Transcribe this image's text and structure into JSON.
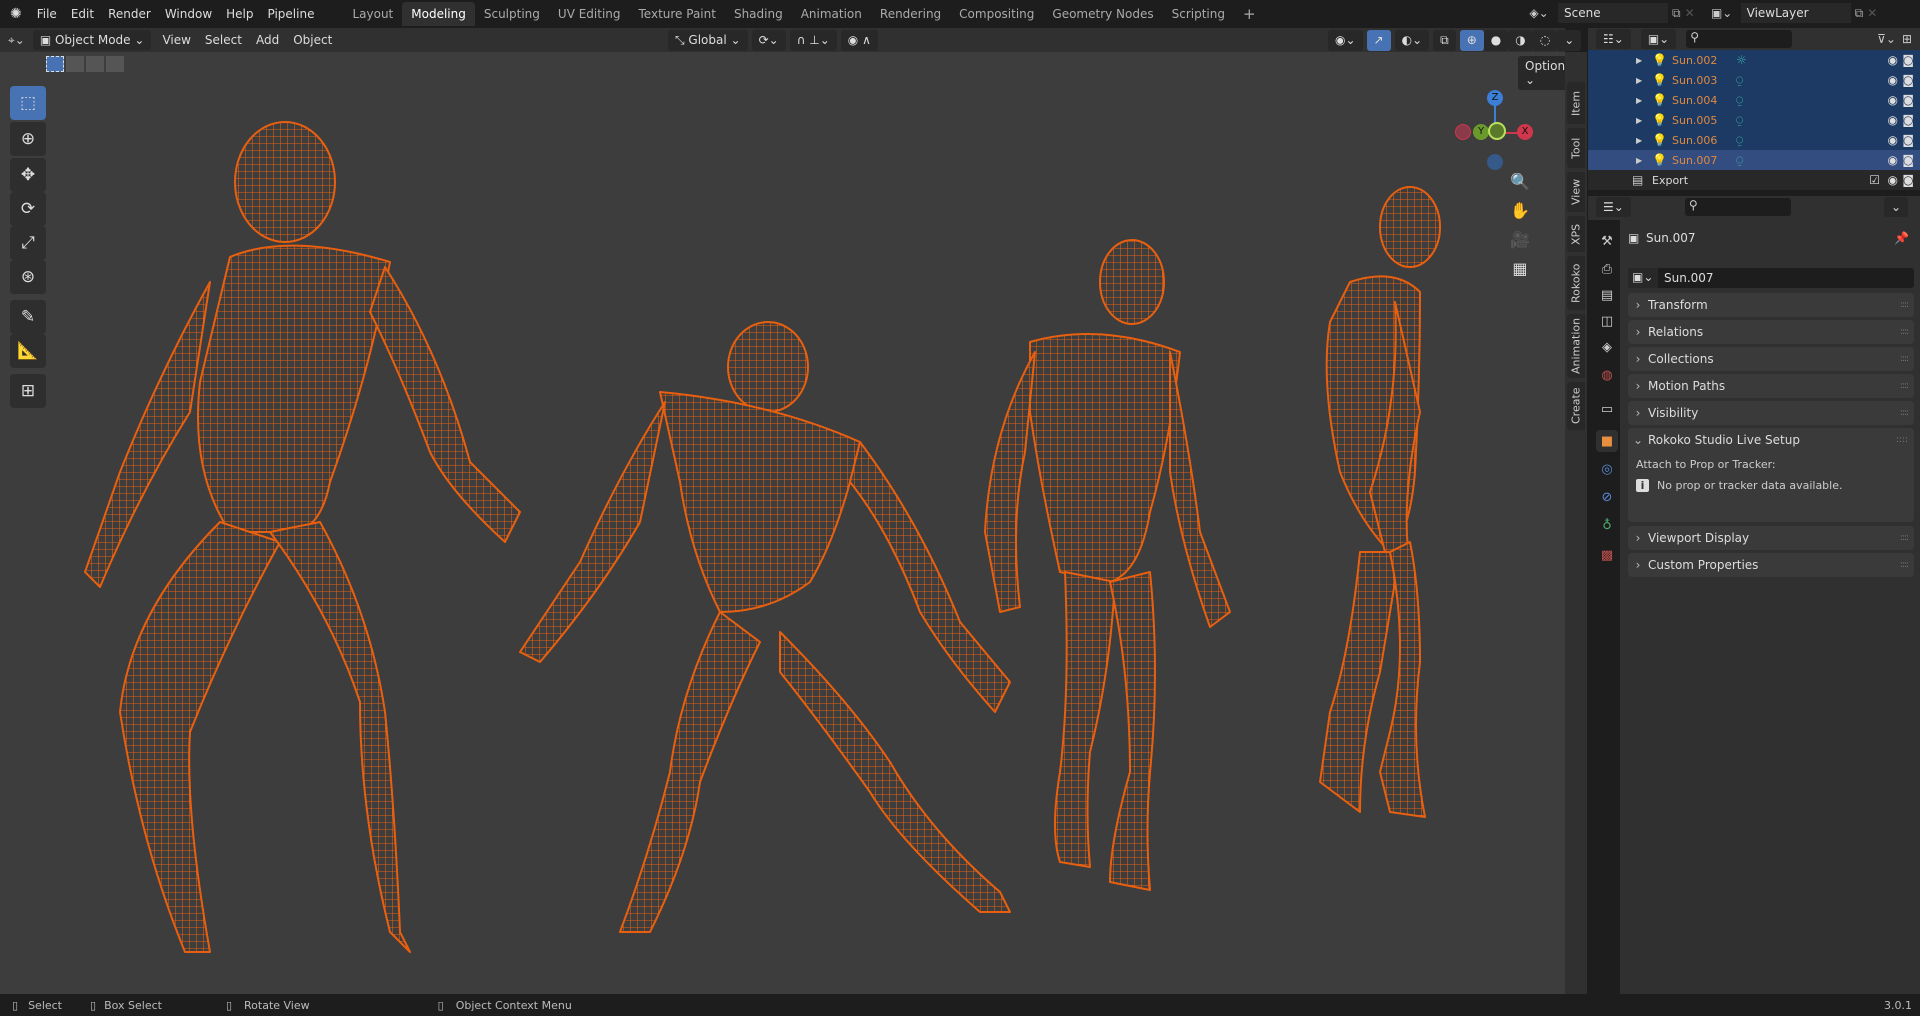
{
  "topbar": {
    "menus": [
      "File",
      "Edit",
      "Render",
      "Window",
      "Help",
      "Pipeline"
    ],
    "workspaces": [
      "Layout",
      "Modeling",
      "Sculpting",
      "UV Editing",
      "Texture Paint",
      "Shading",
      "Animation",
      "Rendering",
      "Compositing",
      "Geometry Nodes",
      "Scripting"
    ],
    "active_workspace": "Modeling",
    "add_tab": "+",
    "scene": "Scene",
    "view_layer": "ViewLayer"
  },
  "viewport_header": {
    "mode": "Object Mode",
    "menus": [
      "View",
      "Select",
      "Add",
      "Object"
    ],
    "orientation": "Global",
    "options": "Options"
  },
  "gizmo": {
    "z": "Z",
    "y": "Y",
    "x": "X"
  },
  "sidebar_tabs": [
    "Item",
    "Tool",
    "View",
    "XPS",
    "Rokoko",
    "Animation",
    "Create"
  ],
  "outliner": {
    "rows": [
      {
        "name": "Sun.002",
        "data_icon": "sun"
      },
      {
        "name": "Sun.003",
        "data_icon": "light"
      },
      {
        "name": "Sun.004",
        "data_icon": "light"
      },
      {
        "name": "Sun.005",
        "data_icon": "light"
      },
      {
        "name": "Sun.006",
        "data_icon": "light"
      },
      {
        "name": "Sun.007",
        "data_icon": "light"
      }
    ],
    "collection": "Export"
  },
  "properties": {
    "object_name": "Sun.007",
    "name_field": "Sun.007",
    "panels": [
      "Transform",
      "Relations",
      "Collections",
      "Motion Paths",
      "Visibility"
    ],
    "rokoko_panel": "Rokoko Studio Live Setup",
    "rokoko_label": "Attach to Prop or Tracker:",
    "rokoko_info": "No prop or tracker data available.",
    "panels_after": [
      "Viewport Display",
      "Custom Properties"
    ]
  },
  "statusbar": {
    "select": "Select",
    "box_select": "Box Select",
    "rotate_view": "Rotate View",
    "context_menu": "Object Context Menu",
    "version": "3.0.1"
  },
  "colors": {
    "accent": "#4772b3",
    "wire": "#e8600f",
    "selected_row": "#1c3a63",
    "active_row": "#334d80",
    "object_name": "#e0893f"
  }
}
